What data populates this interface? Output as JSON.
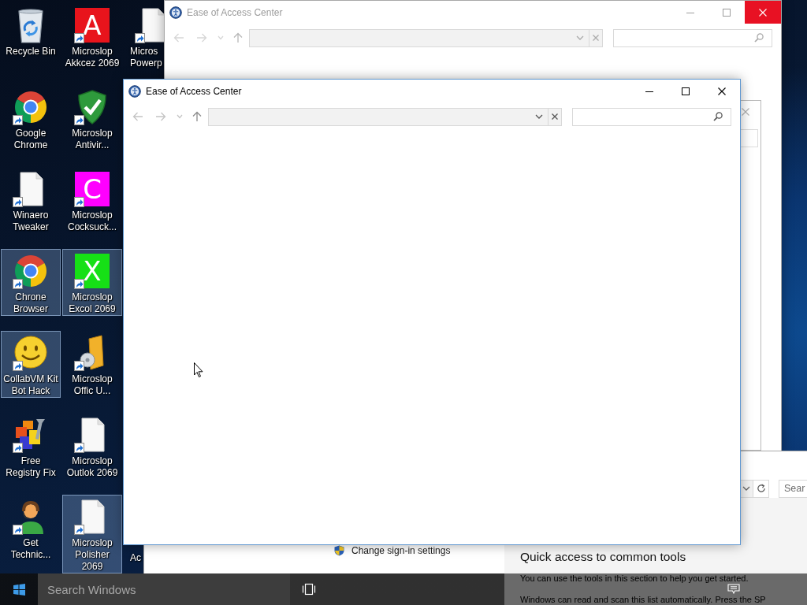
{
  "desktop": {
    "icons": [
      {
        "label": "Recycle Bin",
        "kind": "recycle-bin",
        "shortcut": false,
        "selected": false
      },
      {
        "label": "Google\nChrome",
        "kind": "round-logo",
        "shortcut": true,
        "selected": false
      },
      {
        "label": "Winaero\nTweaker",
        "kind": "document",
        "shortcut": true,
        "selected": false
      },
      {
        "label": "Chrone\nBrowser",
        "kind": "round-logo",
        "shortcut": true,
        "selected": true
      },
      {
        "label": "CollabVM Kit\nBot Hack",
        "kind": "smiley",
        "shortcut": true,
        "selected": true
      },
      {
        "label": "Free\nRegistry Fix",
        "kind": "cubes",
        "shortcut": true,
        "selected": false
      },
      {
        "label": "Get\nTechnic...",
        "kind": "support",
        "shortcut": true,
        "selected": false
      },
      {
        "label": "Microslop\nAkkcez 2069",
        "kind": "letter-tile",
        "letter": "A",
        "color": "#e8141c",
        "shortcut": true,
        "selected": false
      },
      {
        "label": "Microslop\nAntivir...",
        "kind": "shield",
        "shortcut": true,
        "selected": false
      },
      {
        "label": "Microslop\nCocksuck...",
        "kind": "letter-tile",
        "letter": "C",
        "color": "#ff00ff",
        "shortcut": true,
        "selected": false
      },
      {
        "label": "Microslop\nExcol 2069",
        "kind": "letter-tile",
        "letter": "X",
        "color": "#16e016",
        "shortcut": true,
        "selected": true
      },
      {
        "label": "Microslop\nOffic U...",
        "kind": "folder",
        "shortcut": true,
        "selected": false
      },
      {
        "label": "Microslop\nOutlok 2069",
        "kind": "document",
        "shortcut": true,
        "selected": false
      },
      {
        "label": "Microslop\nPolisher\n2069",
        "kind": "document",
        "shortcut": true,
        "selected": true
      }
    ],
    "covered_icons": [
      {
        "label": "Micros\nPowerp",
        "kind": "document",
        "shortcut": true,
        "selected": false
      },
      {
        "label": "Ac",
        "selected": false
      }
    ]
  },
  "windows": [
    {
      "title": "Ease of Access Center",
      "active": false,
      "close_hovered": true
    },
    {
      "title": "Ease of Access Center",
      "active": true,
      "close_hovered": false
    }
  ],
  "lower_window": {
    "search": {
      "placeholder": "Sear"
    },
    "nav_links": [
      {
        "label": "Change sign-in settings"
      }
    ],
    "heading": "Quick access to common tools",
    "paragraphs": [
      "You can use the tools in this section to help you get started.",
      "Windows can read and scan this list automatically. Press the SP"
    ]
  },
  "taskbar": {
    "search": {
      "placeholder": "Search Windows"
    }
  }
}
